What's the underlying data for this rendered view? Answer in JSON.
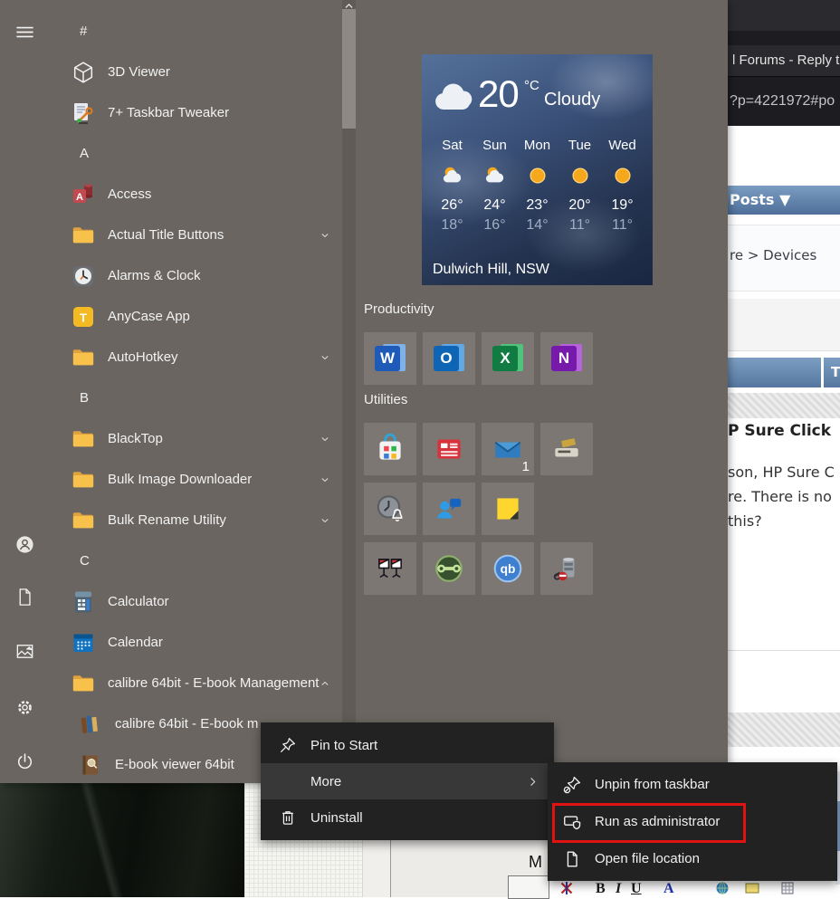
{
  "start_menu": {
    "rail": [
      "hamburger-icon",
      "user-icon",
      "documents-icon",
      "pictures-icon",
      "settings-icon",
      "power-icon"
    ],
    "app_list": [
      {
        "type": "header",
        "label": "#"
      },
      {
        "type": "app",
        "icon": "viewer3d",
        "label": "3D Viewer"
      },
      {
        "type": "app",
        "icon": "tweaker",
        "label": "7+ Taskbar Tweaker"
      },
      {
        "type": "header",
        "label": "A"
      },
      {
        "type": "app",
        "icon": "access",
        "label": "Access"
      },
      {
        "type": "folder",
        "icon": "folder",
        "label": "Actual Title Buttons",
        "chevron": "down"
      },
      {
        "type": "app",
        "icon": "alarms",
        "label": "Alarms & Clock"
      },
      {
        "type": "app",
        "icon": "anycase",
        "label": "AnyCase App"
      },
      {
        "type": "folder",
        "icon": "folder",
        "label": "AutoHotkey",
        "chevron": "down"
      },
      {
        "type": "header",
        "label": "B"
      },
      {
        "type": "folder",
        "icon": "folder",
        "label": "BlackTop",
        "chevron": "down"
      },
      {
        "type": "folder",
        "icon": "folder",
        "label": "Bulk Image Downloader",
        "chevron": "down"
      },
      {
        "type": "folder",
        "icon": "folder",
        "label": "Bulk Rename Utility",
        "chevron": "down"
      },
      {
        "type": "header",
        "label": "C"
      },
      {
        "type": "app",
        "icon": "calculator",
        "label": "Calculator"
      },
      {
        "type": "app",
        "icon": "calendar",
        "label": "Calendar"
      },
      {
        "type": "folder",
        "icon": "folder",
        "label": "calibre 64bit - E-book Management",
        "chevron": "up"
      },
      {
        "type": "app",
        "icon": "calibre",
        "label": "calibre 64bit - E-book m",
        "indent": true
      },
      {
        "type": "app",
        "icon": "ebook",
        "label": "E-book viewer 64bit",
        "indent": true
      }
    ],
    "weather_tile": {
      "temperature": "20",
      "unit": "°C",
      "condition": "Cloudy",
      "location": "Dulwich Hill, NSW",
      "forecast": [
        {
          "day": "Sat",
          "icon": "partly-cloudy",
          "high": "26°",
          "low": "18°"
        },
        {
          "day": "Sun",
          "icon": "partly-cloudy",
          "high": "24°",
          "low": "16°"
        },
        {
          "day": "Mon",
          "icon": "sunny",
          "high": "23°",
          "low": "14°"
        },
        {
          "day": "Tue",
          "icon": "sunny",
          "high": "20°",
          "low": "11°"
        },
        {
          "day": "Wed",
          "icon": "sunny",
          "high": "19°",
          "low": "11°"
        }
      ]
    },
    "tile_groups": [
      {
        "label": "Productivity",
        "rows": [
          [
            {
              "icon": "word",
              "letter": "W",
              "color": "#1e5bb8",
              "color2": "#7fb0e8"
            },
            {
              "icon": "outlook",
              "letter": "O",
              "color": "#0e64b5",
              "color2": "#61a8e4"
            },
            {
              "icon": "excel",
              "letter": "X",
              "color": "#107c41",
              "color2": "#4fc27c"
            },
            {
              "icon": "onenote",
              "letter": "N",
              "color": "#7719aa",
              "color2": "#b565d9"
            }
          ]
        ]
      },
      {
        "label": "Utilities",
        "rows": [
          [
            {
              "icon": "store"
            },
            {
              "icon": "news"
            },
            {
              "icon": "mail",
              "badge": "1"
            },
            {
              "icon": "scanner"
            }
          ],
          [
            {
              "icon": "clock-bell"
            },
            {
              "icon": "people"
            },
            {
              "icon": "sticky-notes"
            },
            null
          ],
          [
            {
              "icon": "media-flags"
            },
            {
              "icon": "green-wrench"
            },
            {
              "icon": "qbittorrent",
              "letter": "qb"
            },
            {
              "icon": "database"
            }
          ]
        ]
      }
    ]
  },
  "context_menu": {
    "items": [
      {
        "icon": "pin-icon",
        "label": "Pin to Start"
      },
      {
        "label": "More",
        "submenu": true,
        "highlighted": true
      },
      {
        "icon": "trash-icon",
        "label": "Uninstall"
      }
    ]
  },
  "taskbar_submenu": {
    "highlight_color": "#e01212",
    "items": [
      {
        "icon": "unpin-icon",
        "label": "Unpin from taskbar"
      },
      {
        "icon": "admin-icon",
        "label": "Run as administrator",
        "highlighted_box": true
      },
      {
        "icon": "open-location-icon",
        "label": "Open file location"
      }
    ]
  },
  "browser": {
    "tab_title": "l Forums - Reply to",
    "url_fragment": "?p=4221972#po",
    "posts_label": "Posts ▼",
    "breadcrumb": "re > Devices",
    "table_header_fragment": "T",
    "heading_fragment": "P Sure Click",
    "body_lines": [
      "son, HP Sure C",
      "re. There is no",
      "this?"
    ]
  },
  "desktop": {
    "editor_label": "M",
    "toolbar_letters": [
      "B",
      "I",
      "U",
      "A"
    ]
  }
}
